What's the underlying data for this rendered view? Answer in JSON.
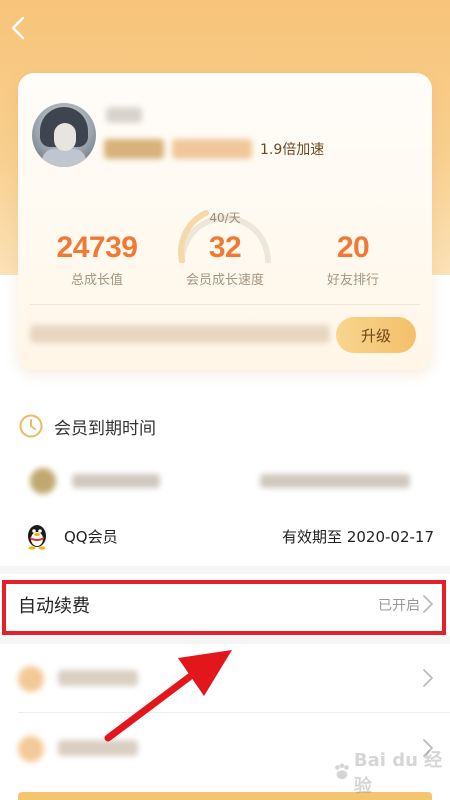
{
  "colors": {
    "accent": "#f07a35",
    "highlight_box": "#e5202a",
    "arrow": "#e3161b"
  },
  "profile": {
    "accel_text": "1.9倍加速"
  },
  "gauge": {
    "rate": "40/天"
  },
  "stats": {
    "total_growth": {
      "value": "24739",
      "label": "总成长值"
    },
    "growth_speed": {
      "value": "32",
      "label": "会员成长速度"
    },
    "friend_rank": {
      "value": "20",
      "label": "好友排行"
    }
  },
  "upgrade_label": "升级",
  "membership": {
    "section_title": "会员到期时间",
    "section_icon": "clock-icon",
    "qq_vip": {
      "name": "QQ会员",
      "expiry": "有效期至 2020-02-17",
      "icon": "qq-penguin-icon"
    }
  },
  "auto_renew": {
    "label": "自动续费",
    "status": "已开启"
  },
  "watermark": {
    "text": "Bai du 经验"
  }
}
